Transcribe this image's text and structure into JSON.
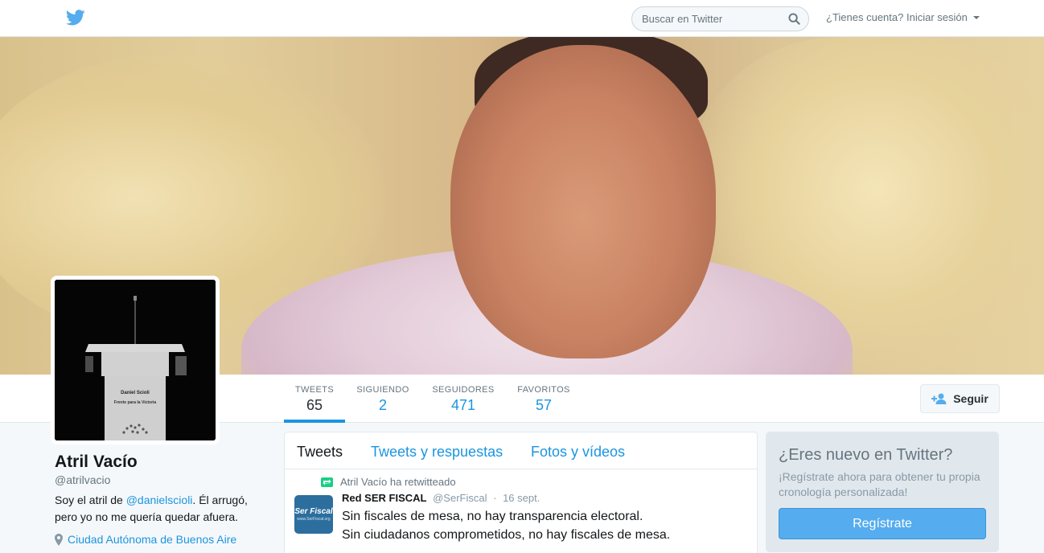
{
  "header": {
    "search_placeholder": "Buscar en Twitter",
    "login_prompt": "¿Tienes cuenta?",
    "login_link": "Iniciar sesión"
  },
  "profile": {
    "name": "Atril Vacío",
    "handle": "@atrilvacio",
    "bio_prefix": "Soy el atril de ",
    "bio_mention": "@danielscioli",
    "bio_suffix": ". Él arrugó, pero yo no me quería quedar afuera.",
    "location": "Ciudad Autónoma de Buenos Aire",
    "avatar_podium_text_1": "Daniel Scioli",
    "avatar_podium_text_2": "Frente para la Victoria"
  },
  "stats": [
    {
      "label": "TWEETS",
      "value": "65"
    },
    {
      "label": "SIGUIENDO",
      "value": "2"
    },
    {
      "label": "SEGUIDORES",
      "value": "471"
    },
    {
      "label": "FAVORITOS",
      "value": "57"
    }
  ],
  "follow_button": "Seguir",
  "timeline": {
    "tabs": [
      "Tweets",
      "Tweets y respuestas",
      "Fotos y vídeos"
    ],
    "tweet": {
      "retweet_context": "Atril Vacío ha retwitteado",
      "author_name": "Red SER FISCAL",
      "author_handle": "@SerFiscal",
      "separator": "·",
      "date": "16 sept.",
      "line1": "Sin fiscales de mesa, no hay transparencia electoral.",
      "line2": "Sin ciudadanos comprometidos, no hay fiscales de mesa.",
      "avatar_text": "Ser Fiscal",
      "avatar_subtext": "www.SerFiscal.org"
    }
  },
  "signup": {
    "title": "¿Eres nuevo en Twitter?",
    "text": "¡Regístrate ahora para obtener tu propia cronología personalizada!",
    "button": "Regístrate"
  },
  "colors": {
    "accent": "#1b95e0",
    "twitter_blue": "#55acee",
    "retweet_green": "#19cf86"
  },
  "icons": [
    "twitter-bird-icon",
    "search-icon",
    "caret-down-icon",
    "follow-user-icon",
    "location-pin-icon",
    "retweet-icon"
  ]
}
